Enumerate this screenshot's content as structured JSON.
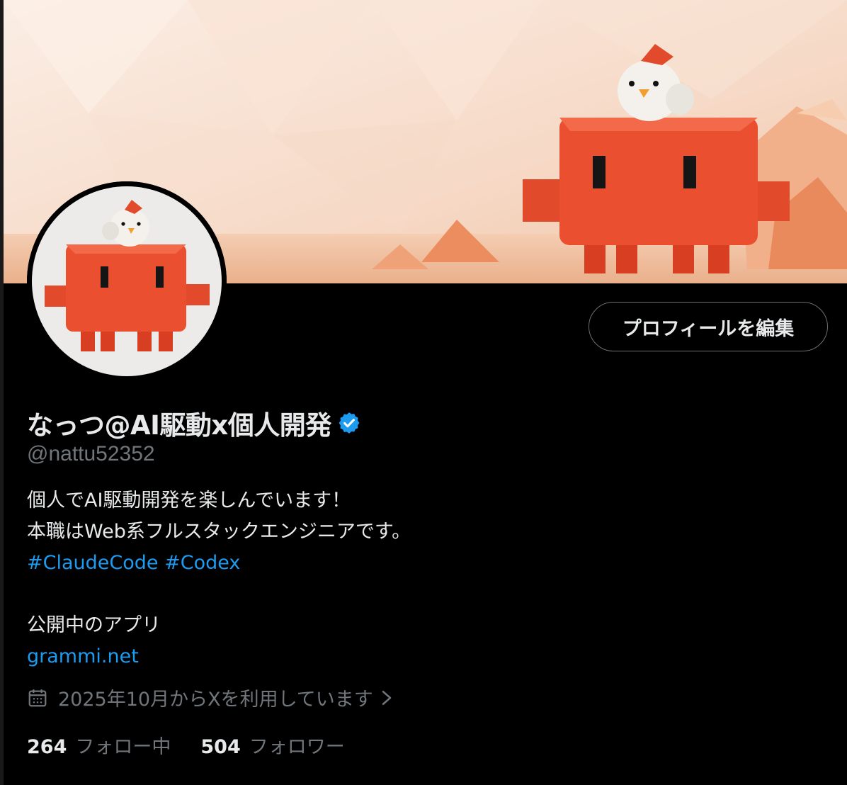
{
  "profile": {
    "display_name": "なっつ@AI駆動x個人開発",
    "handle": "@nattu52352",
    "edit_button": "プロフィールを編集",
    "bio_line_1": "個人でAI駆動開発を楽しんでいます！",
    "bio_line_2": "本職はWeb系フルスタックエンジニアです。",
    "hashtag_1": "#ClaudeCode",
    "hashtag_2": "#Codex",
    "apps_label": "公開中のアプリ",
    "apps_link": "grammi.net",
    "joined": "2025年10月からXを利用しています",
    "following_count": "264",
    "following_label": "フォロー中",
    "followers_count": "504",
    "followers_label": "フォロワー"
  },
  "icons": {
    "verified": "verified-badge-icon",
    "calendar": "calendar-icon",
    "chevron": "chevron-right-icon"
  },
  "colors": {
    "background": "#000000",
    "text_primary": "#e7e9ea",
    "text_secondary": "#71767b",
    "accent": "#1d9bf0",
    "banner_bg": "#f6dccb",
    "mascot": "#e8462c"
  }
}
